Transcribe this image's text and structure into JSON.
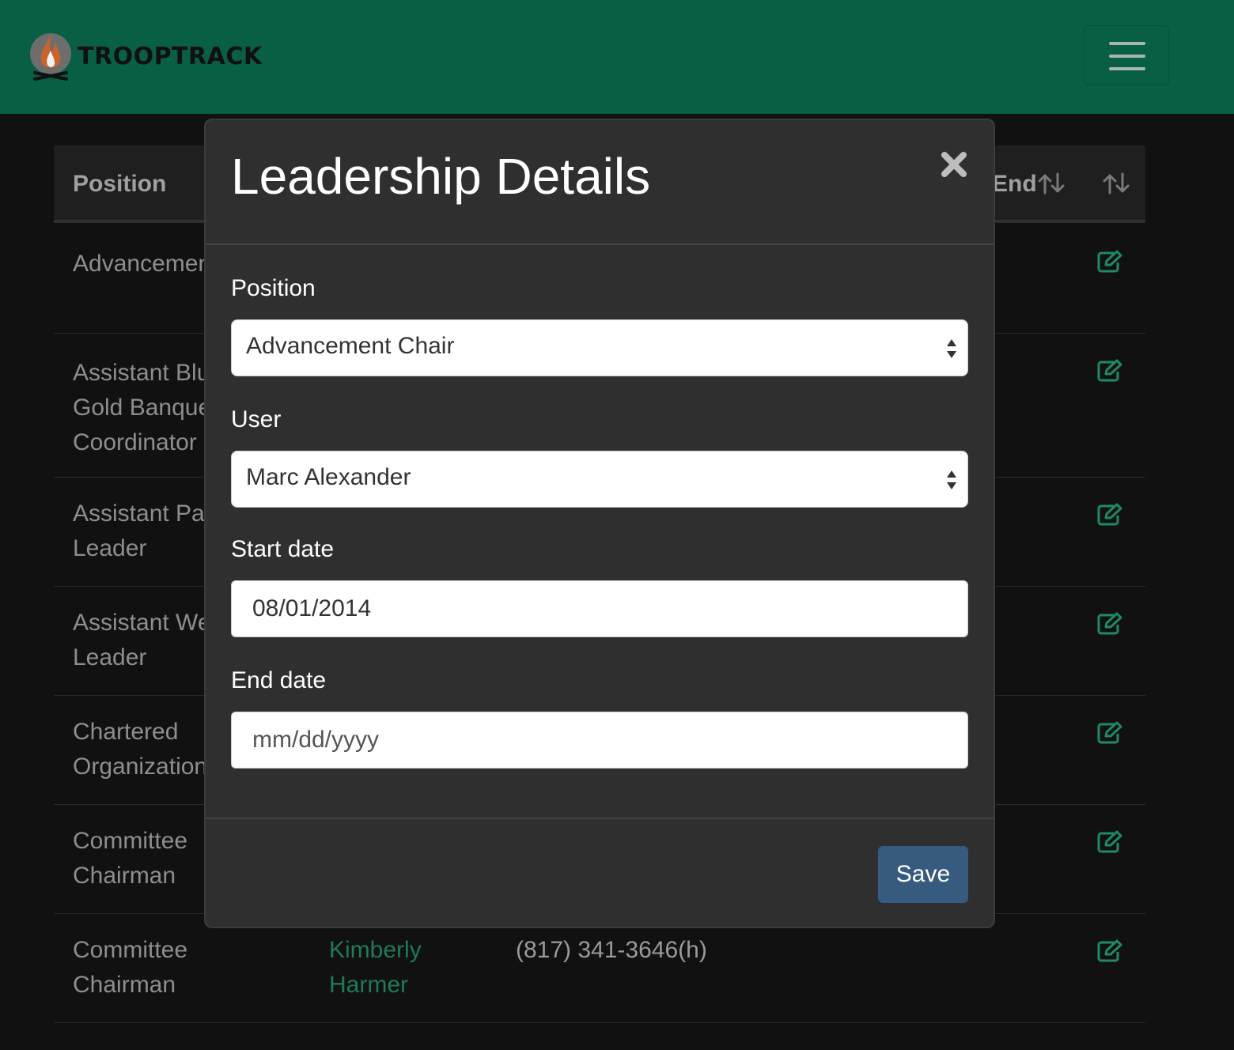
{
  "navbar": {
    "brand": "TROOPTRACK",
    "colors": {
      "background": "#085f45"
    }
  },
  "table": {
    "headers": {
      "position": "Position",
      "end": "End"
    },
    "rows": [
      {
        "position": [
          "Advancement Chair"
        ],
        "user": [],
        "phone": ""
      },
      {
        "position": [
          "Assistant Blue and",
          "Gold Banquet",
          "Coordinator"
        ],
        "user": [],
        "phone": ""
      },
      {
        "position": [
          "Assistant Patrol",
          "Leader"
        ],
        "user": [],
        "phone": ""
      },
      {
        "position": [
          "Assistant Webelos",
          "Leader"
        ],
        "user": [],
        "phone": ""
      },
      {
        "position": [
          "Chartered",
          "Organization"
        ],
        "user": [],
        "phone": ""
      },
      {
        "position": [
          "Committee",
          "Chairman"
        ],
        "user": [],
        "phone": ""
      },
      {
        "position": [
          "Committee",
          "Chairman"
        ],
        "user": [
          "Kimberly",
          "Harmer"
        ],
        "phone": "(817) 341-3646(h)"
      }
    ],
    "colors": {
      "link": "#1f7a57",
      "edit_icon": "#1f8a63"
    }
  },
  "modal": {
    "title": "Leadership Details",
    "close_icon": "close-icon",
    "fields": {
      "position": {
        "label": "Position",
        "value": "Advancement Chair"
      },
      "user": {
        "label": "User",
        "value": "Marc Alexander"
      },
      "start_date": {
        "label": "Start date",
        "value": "08/01/2014"
      },
      "end_date": {
        "label": "End date",
        "placeholder": "mm/dd/yyyy"
      }
    },
    "save_label": "Save",
    "colors": {
      "save_button": "#375a7f",
      "background": "#2f2f2f"
    }
  }
}
